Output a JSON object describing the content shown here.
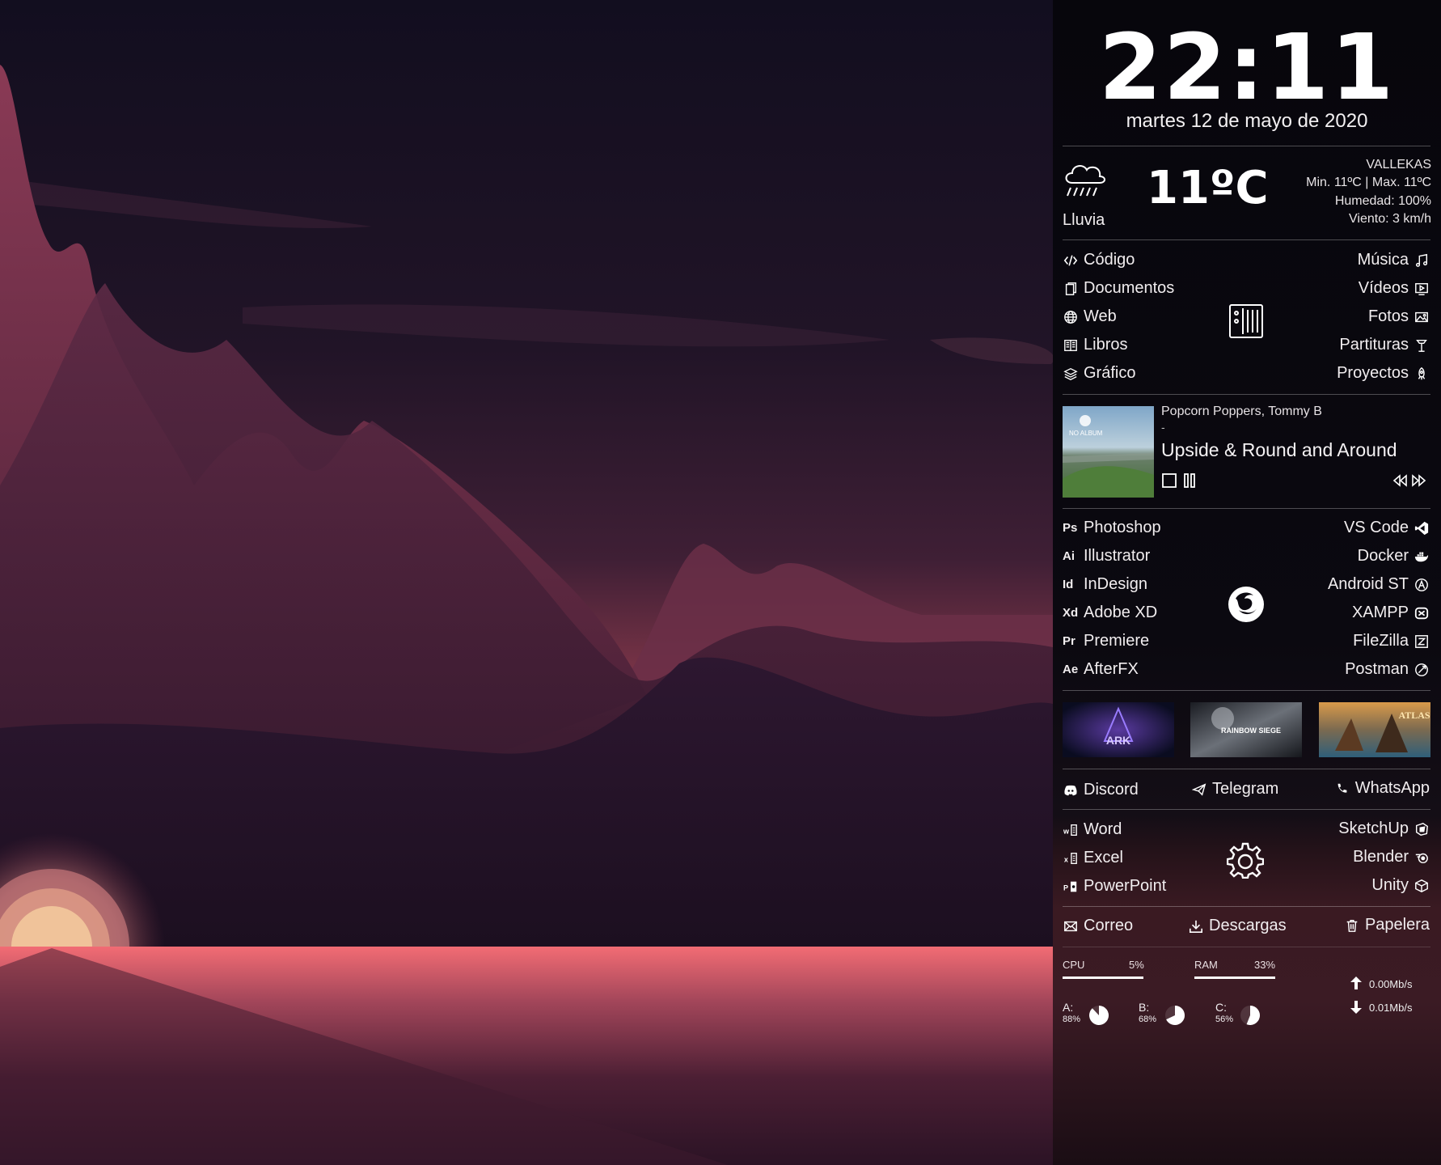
{
  "clock": {
    "time": "22:11",
    "date": "martes 12 de mayo de 2020"
  },
  "weather": {
    "icon": "rain-cloud-icon",
    "condition": "Lluvia",
    "temperature": "11ºC",
    "location": "VALLEKAS",
    "minmax": "Min. 11ºC | Max. 11ºC",
    "humidity": "Humedad: 100%",
    "wind": "Viento: 3 km/h"
  },
  "folders": {
    "left": [
      {
        "label": "Código",
        "icon": "code-icon"
      },
      {
        "label": "Documentos",
        "icon": "document-icon"
      },
      {
        "label": "Web",
        "icon": "globe-icon"
      },
      {
        "label": "Libros",
        "icon": "book-icon"
      },
      {
        "label": "Gráfico",
        "icon": "layers-icon"
      }
    ],
    "right": [
      {
        "label": "Música",
        "icon": "music-note-icon"
      },
      {
        "label": "Vídeos",
        "icon": "video-icon"
      },
      {
        "label": "Fotos",
        "icon": "image-icon"
      },
      {
        "label": "Partituras",
        "icon": "metronome-icon"
      },
      {
        "label": "Proyectos",
        "icon": "rocket-icon"
      }
    ],
    "center_icon": "file-cabinet-icon"
  },
  "now_playing": {
    "artist": "Popcorn Poppers, Tommy B",
    "separator": "-",
    "title": "Upside & Round and Around",
    "album_label": "NO ALBUM"
  },
  "apps": {
    "left": [
      {
        "abbr": "Ps",
        "label": "Photoshop"
      },
      {
        "abbr": "Ai",
        "label": "Illustrator"
      },
      {
        "abbr": "Id",
        "label": "InDesign"
      },
      {
        "abbr": "Xd",
        "label": "Adobe XD"
      },
      {
        "abbr": "Pr",
        "label": "Premiere"
      },
      {
        "abbr": "Ae",
        "label": "AfterFX"
      }
    ],
    "right": [
      {
        "label": "VS Code",
        "icon": "vscode-icon"
      },
      {
        "label": "Docker",
        "icon": "docker-icon"
      },
      {
        "label": "Android ST",
        "icon": "android-studio-icon"
      },
      {
        "label": "XAMPP",
        "icon": "xampp-icon"
      },
      {
        "label": "FileZilla",
        "icon": "filezilla-icon"
      },
      {
        "label": "Postman",
        "icon": "postman-icon"
      }
    ],
    "center_icon": "firefox-icon"
  },
  "games": [
    {
      "name": "ARK",
      "label": "ARK"
    },
    {
      "name": "rainbow-six-siege",
      "label": "RAINBOW SIEGE"
    },
    {
      "name": "atlas",
      "label": "ATLAS"
    }
  ],
  "messaging": [
    {
      "label": "Discord",
      "icon": "discord-icon"
    },
    {
      "label": "Telegram",
      "icon": "telegram-icon"
    },
    {
      "label": "WhatsApp",
      "icon": "phone-icon"
    }
  ],
  "office": {
    "left": [
      {
        "label": "Word",
        "icon": "word-icon"
      },
      {
        "label": "Excel",
        "icon": "excel-icon"
      },
      {
        "label": "PowerPoint",
        "icon": "powerpoint-icon"
      }
    ],
    "right": [
      {
        "label": "SketchUp",
        "icon": "sketchup-icon"
      },
      {
        "label": "Blender",
        "icon": "blender-icon"
      },
      {
        "label": "Unity",
        "icon": "unity-icon"
      }
    ],
    "center_icon": "gear-icon"
  },
  "utilities": [
    {
      "label": "Correo",
      "icon": "mail-icon"
    },
    {
      "label": "Descargas",
      "icon": "download-icon"
    },
    {
      "label": "Papelera",
      "icon": "trash-icon"
    }
  ],
  "system": {
    "cpu_label": "CPU",
    "cpu_value": "5%",
    "cpu_fraction": 1.0,
    "ram_label": "RAM",
    "ram_value": "33%",
    "ram_fraction": 1.0,
    "upload": "0.00Mb/s",
    "download": "0.01Mb/s",
    "disks": [
      {
        "label": "A:",
        "value": "88%",
        "fraction": 0.88
      },
      {
        "label": "B:",
        "value": "68%",
        "fraction": 0.68
      },
      {
        "label": "C:",
        "value": "56%",
        "fraction": 0.56
      }
    ]
  }
}
